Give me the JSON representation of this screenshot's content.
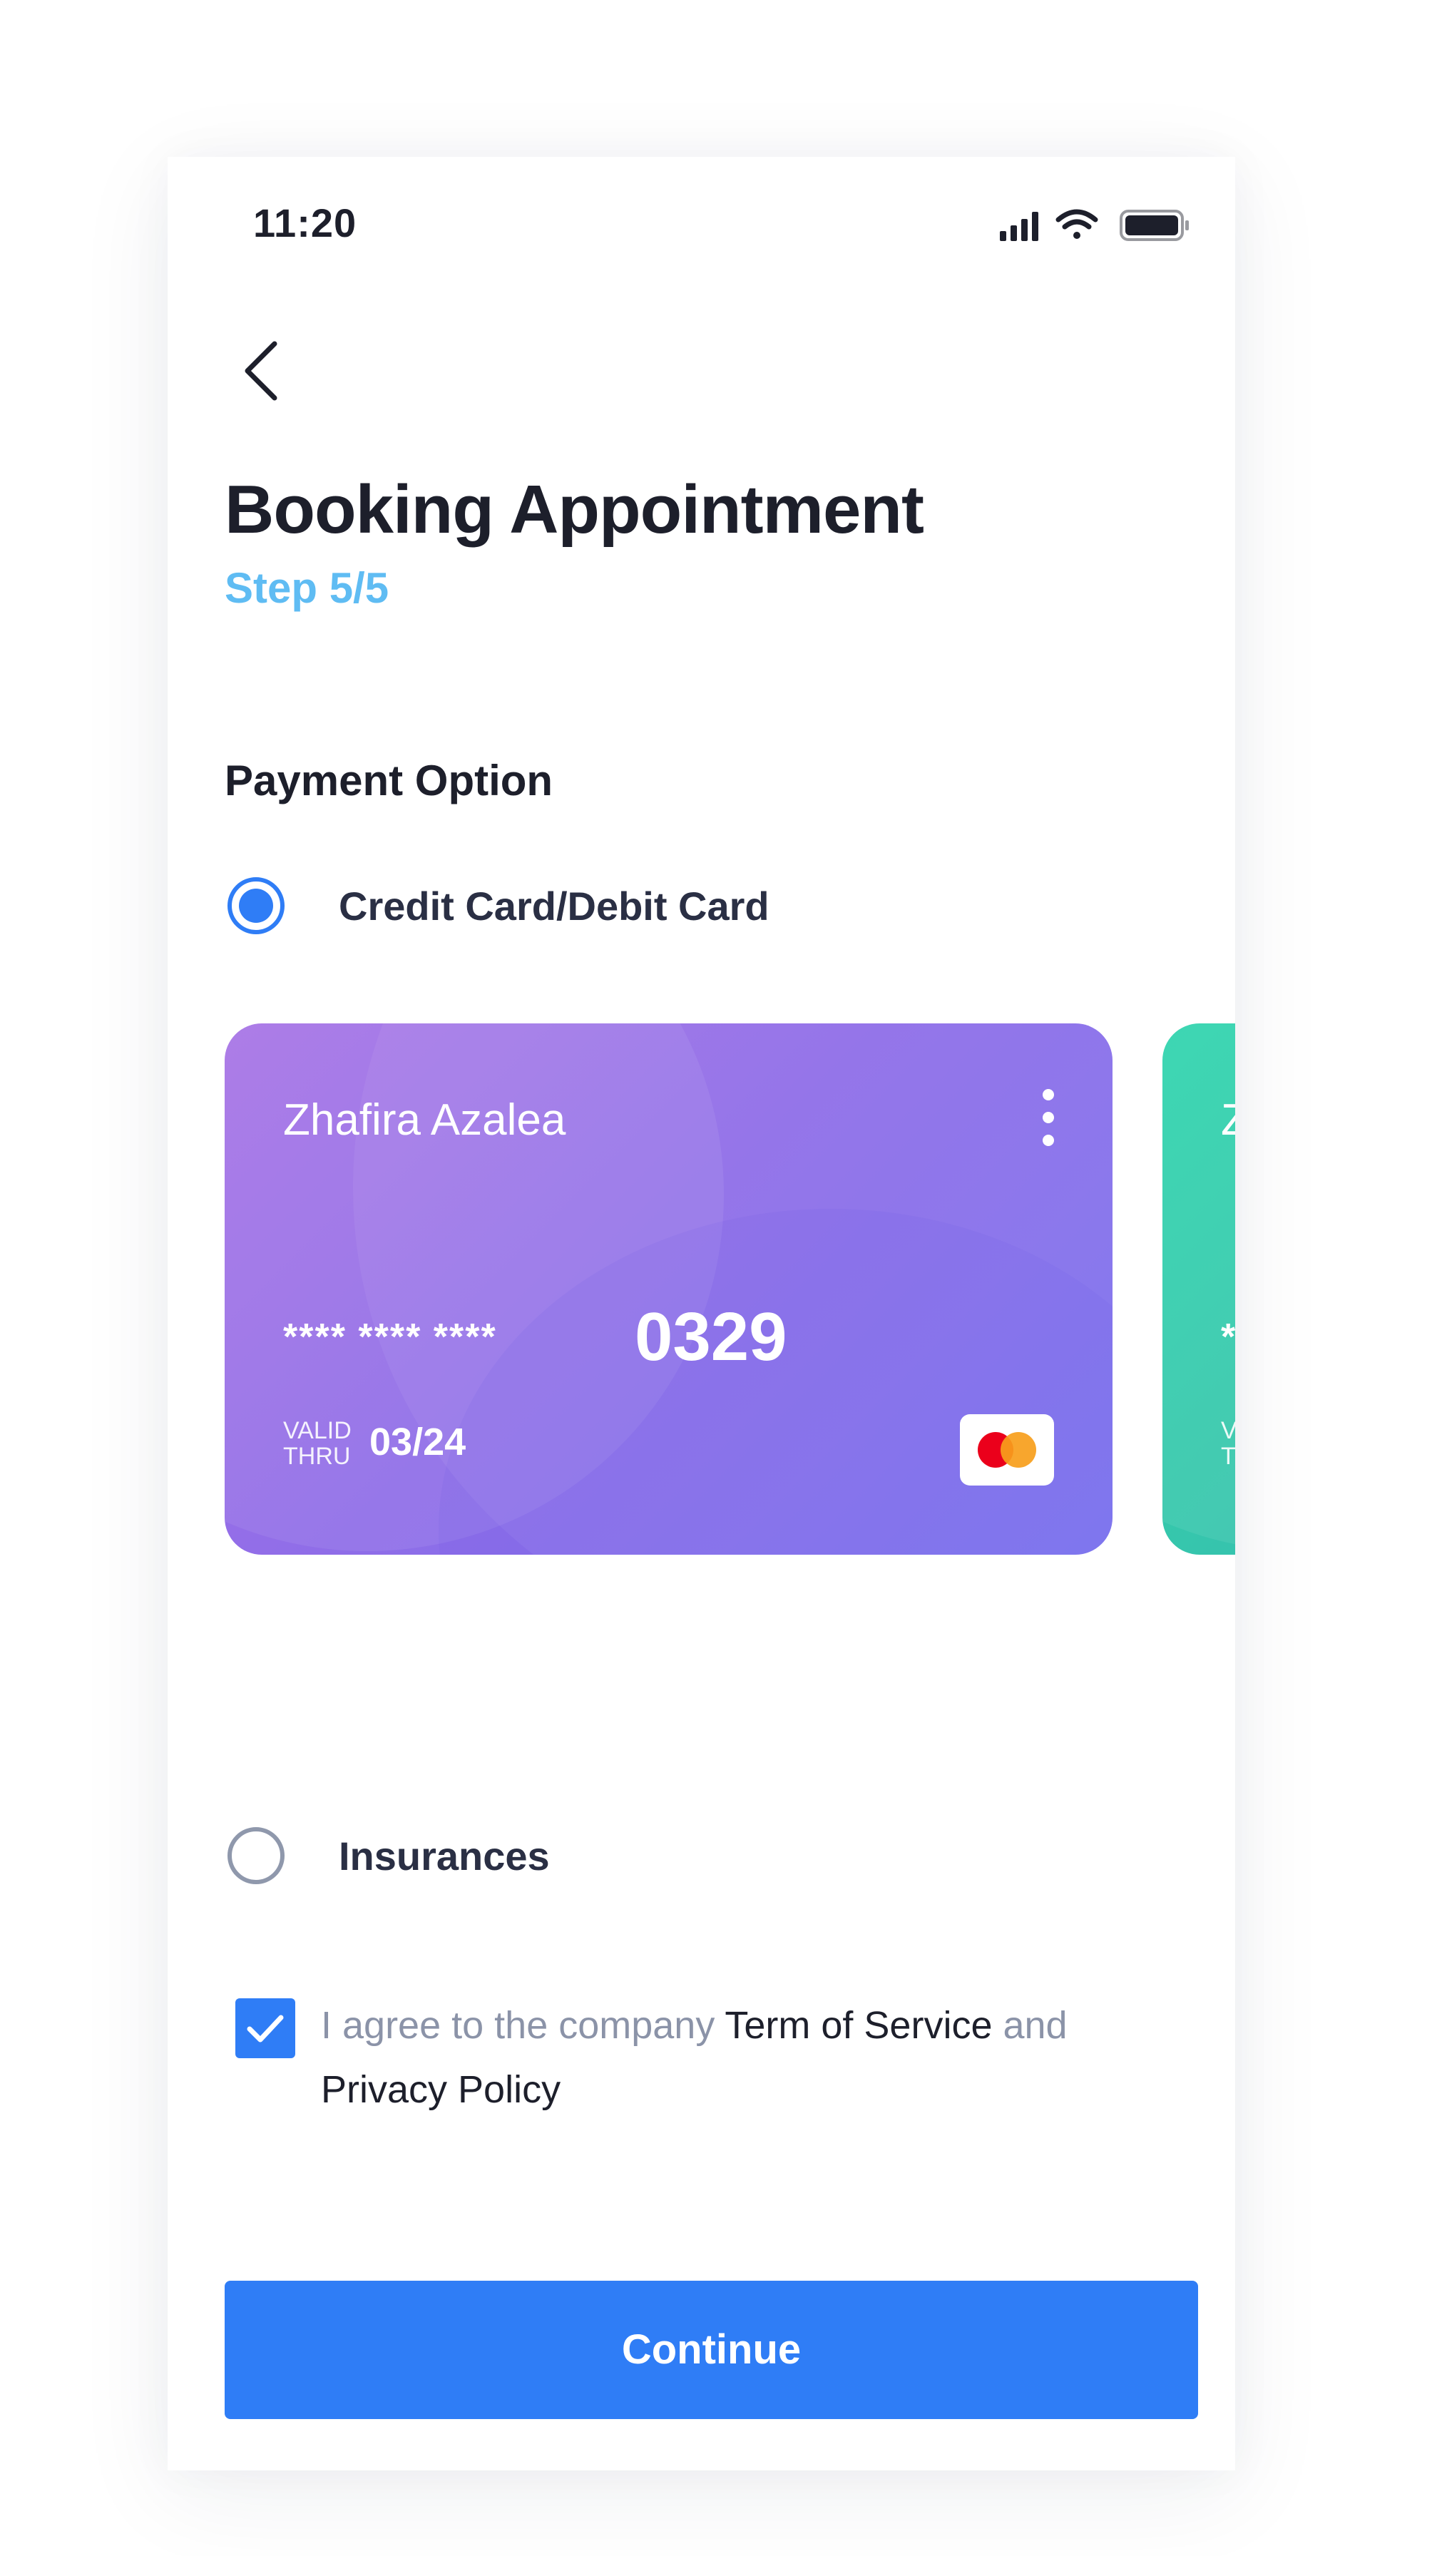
{
  "status_bar": {
    "time": "11:20"
  },
  "header": {
    "title": "Booking Appointment",
    "step": "Step 5/5"
  },
  "payment": {
    "section_label": "Payment Option",
    "options": [
      {
        "label": "Credit Card/Debit Card",
        "selected": true
      },
      {
        "label": "Insurances",
        "selected": false
      }
    ],
    "cards": [
      {
        "holder": "Zhafira Azalea",
        "masked": "**** **** ****",
        "last4": "0329",
        "valid_label": "VALID THRU",
        "expiry": "03/24",
        "brand": "mastercard",
        "color": "#9570e8"
      },
      {
        "holder_partial": "Zh",
        "masked_partial": "**",
        "valid_partial": "VAL THR",
        "color": "#33cdb0"
      }
    ]
  },
  "agreement": {
    "checked": true,
    "prefix": "I agree to the company ",
    "tos": "Term of Service",
    "and": " and",
    "privacy": "Privacy Policy"
  },
  "footer": {
    "continue_label": "Continue"
  },
  "colors": {
    "accent": "#2f7df6",
    "step": "#5fbcf3",
    "text_dark": "#1d1f2b",
    "text_muted": "#8b93a8"
  }
}
